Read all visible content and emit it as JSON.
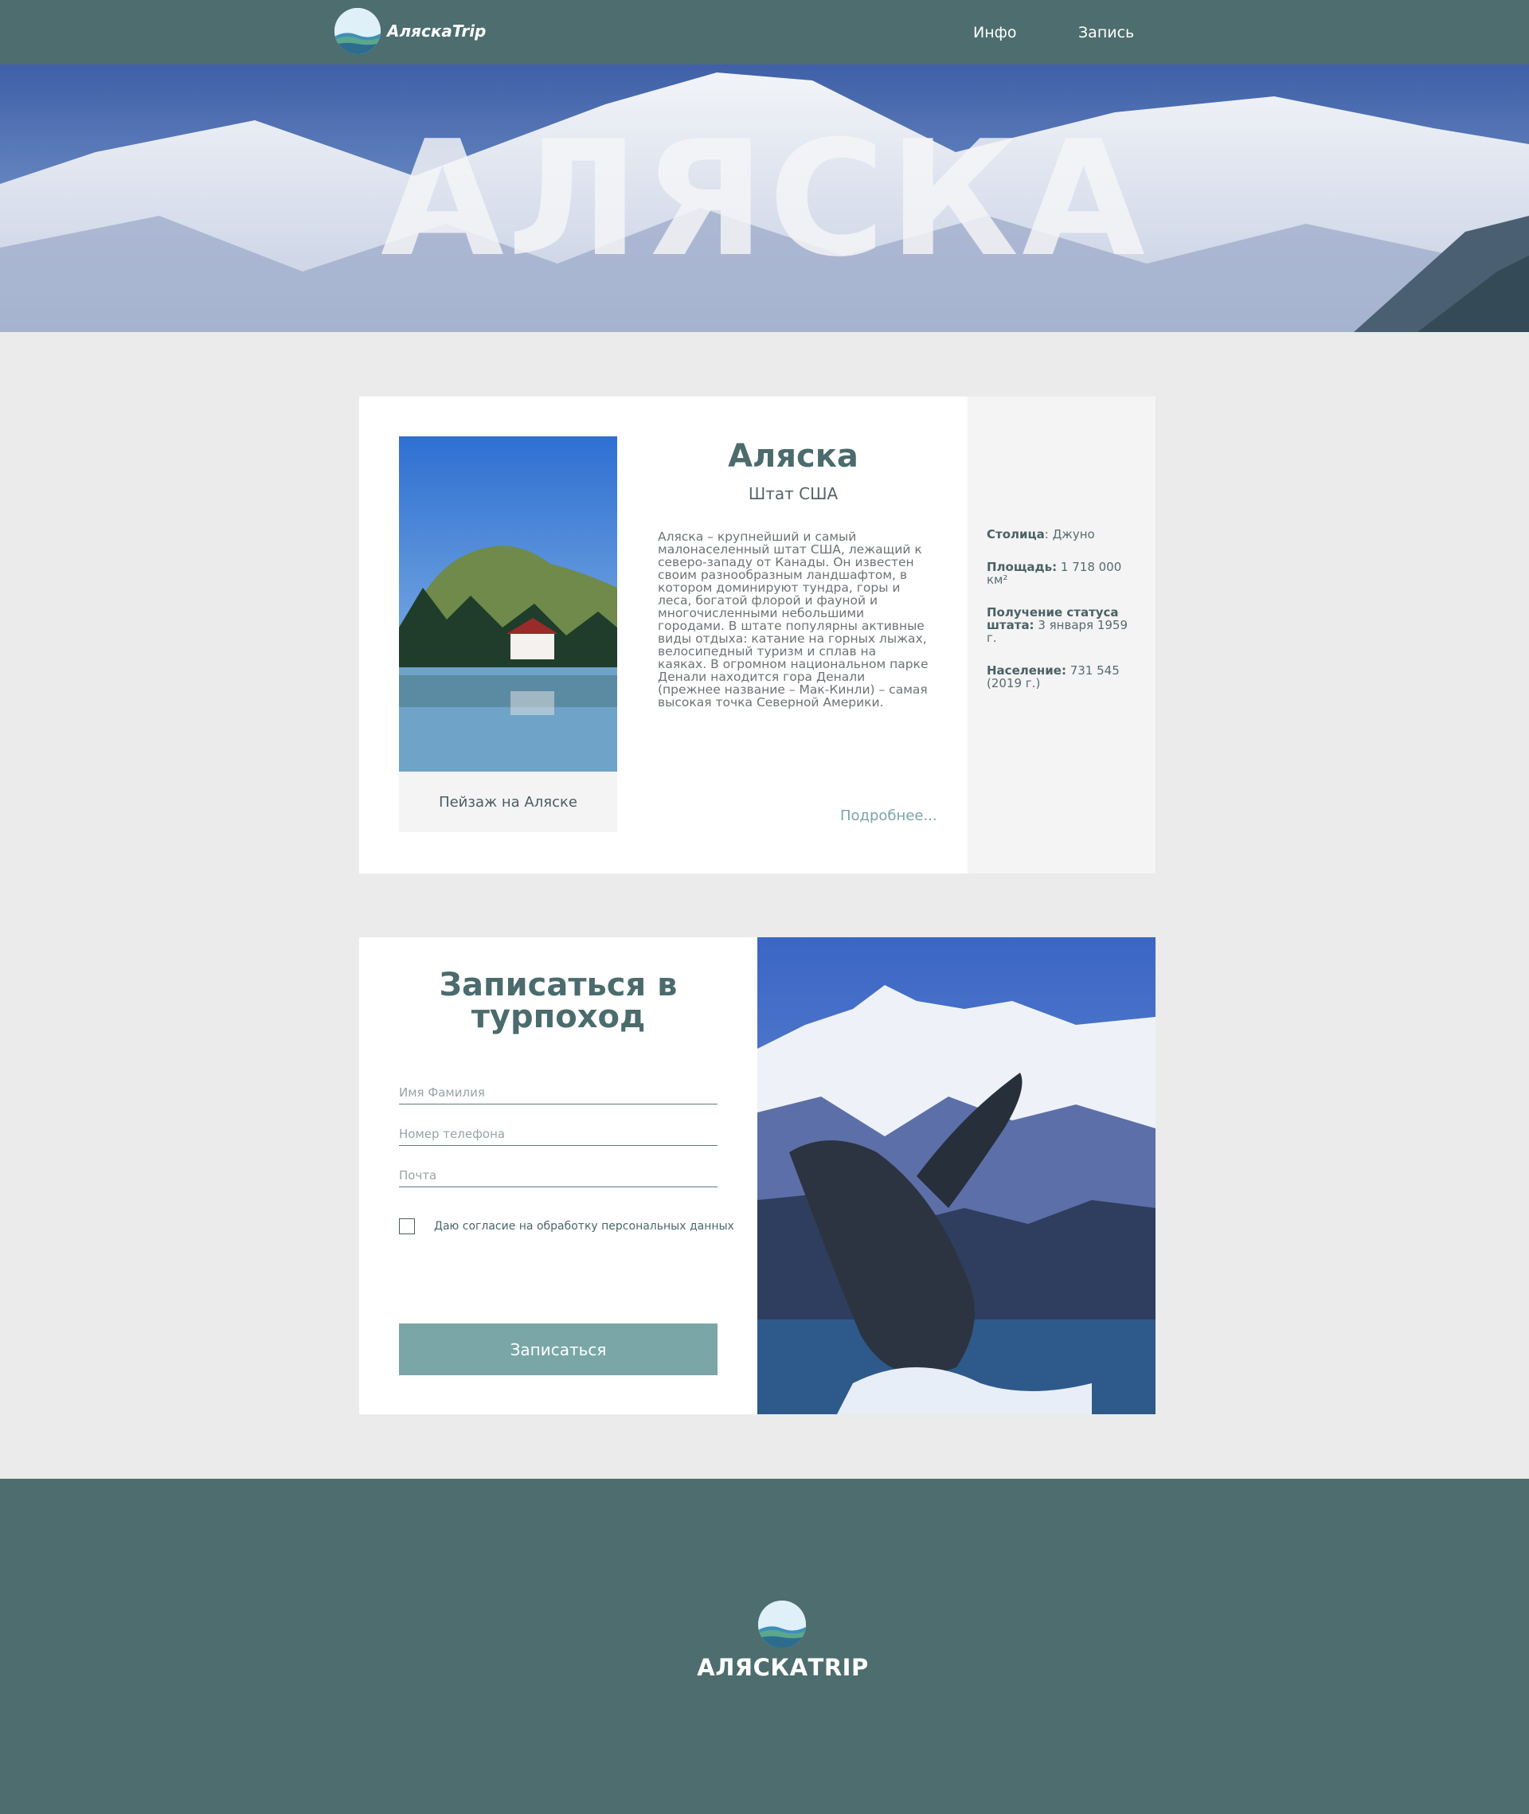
{
  "header": {
    "brand": "АляскаTrip",
    "nav": {
      "info": "Инфо",
      "signup": "Запись"
    }
  },
  "hero": {
    "title": "АЛЯСКА"
  },
  "info": {
    "title": "Аляска",
    "subtitle": "Штат США",
    "description": "Аляска – крупнейший и самый малонаселенный штат США, лежащий к северо-западу от Канады. Он известен своим разнообразным ландшафтом, в котором доминируют тундра, горы и леса, богатой флорой и фауной и многочисленными небольшими городами. В штате популярны активные виды отдыха: катание на горных лыжах, велосипедный туризм и сплав на каяках. В огромном национальном парке Денали находится гора Денали (прежнее название – Мак-Кинли) – самая высокая точка Северной Америки.",
    "photo_caption": "Пейзаж на Аляске",
    "more_link": "Подробнее...",
    "facts": [
      {
        "label": "Столица",
        "sep": ":",
        "value": " Джуно"
      },
      {
        "label": "Площадь:",
        "sep": "",
        "value": " 1 718 000 км²"
      },
      {
        "label": "Получение статуса штата:",
        "sep": "",
        "value": " 3 января 1959 г."
      },
      {
        "label": "Население:",
        "sep": "",
        "value": " 731 545 (2019 г.)"
      }
    ]
  },
  "form": {
    "title": "Записаться в турпоход",
    "fields": {
      "name_placeholder": "Имя Фамилия",
      "phone_placeholder": "Номер телефона",
      "email_placeholder": "Почта"
    },
    "consent_label": "Даю согласие на обработку персональных данных",
    "submit_label": "Записаться"
  },
  "footer": {
    "brand": "АЛЯСКАTRIP"
  },
  "colors": {
    "header_bg": "#4d6d6e",
    "page_bg": "#ebebeb",
    "accent": "#7aa6a8",
    "heading": "#4b6b6d"
  }
}
